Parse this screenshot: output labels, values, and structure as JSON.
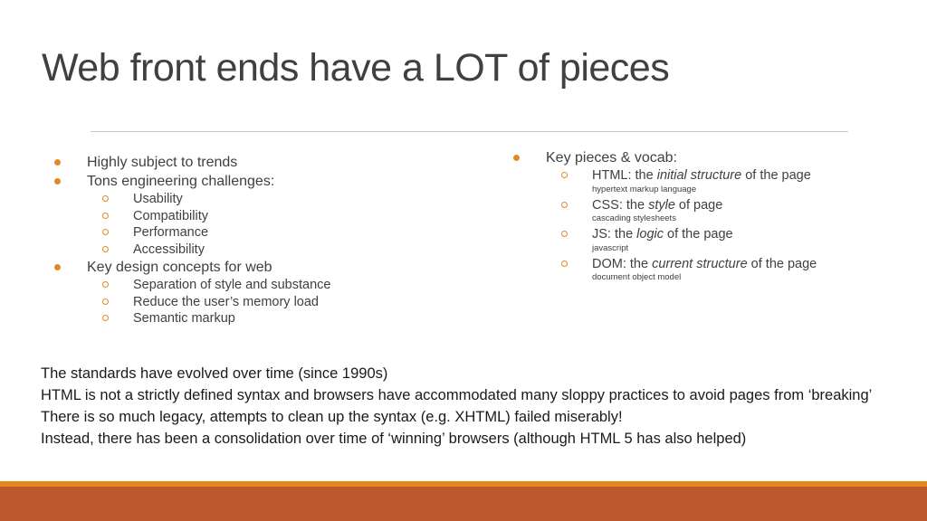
{
  "slide": {
    "title": "Web front ends have a LOT of pieces",
    "accent_color": "#e48a22",
    "footer_colors": {
      "stripe": "#e08a1e",
      "bar": "#bd582c"
    }
  },
  "left_list": [
    {
      "text": "Highly subject to trends",
      "children": []
    },
    {
      "text": "Tons engineering challenges:",
      "children": [
        "Usability",
        "Compatibility",
        "Performance",
        "Accessibility"
      ]
    },
    {
      "text": "Key design concepts for web",
      "children": [
        "Separation of style and substance",
        "Reduce the user’s memory load",
        "Semantic markup"
      ]
    }
  ],
  "right_list": {
    "heading": "Key pieces & vocab:",
    "items": [
      {
        "prefix": "HTML: the ",
        "emphasis": "initial structure",
        "suffix": " of the page",
        "note": "hypertext markup language"
      },
      {
        "prefix": "CSS: the ",
        "emphasis": "style",
        "suffix": " of page",
        "note": "cascading stylesheets"
      },
      {
        "prefix": "JS: the ",
        "emphasis": "logic",
        "suffix": " of the page",
        "note": "javascript"
      },
      {
        "prefix": "DOM: the ",
        "emphasis": "current structure",
        "suffix": " of the page",
        "note": "document object model"
      }
    ]
  },
  "body_paragraphs": [
    "The standards have evolved over time (since 1990s)",
    "HTML is not a strictly defined syntax and browsers have accommodated many sloppy practices to avoid pages from ‘breaking’",
    "There is so much legacy, attempts to clean up the syntax (e.g. XHTML) failed miserably!",
    "Instead, there has been a consolidation over time of ‘winning’ browsers (although HTML 5 has also helped)"
  ]
}
